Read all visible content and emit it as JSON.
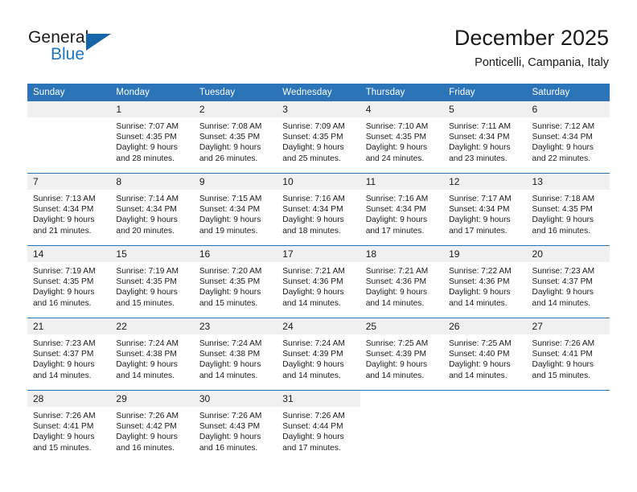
{
  "brand": {
    "name_top": "General",
    "name_bottom": "Blue",
    "flag_icon": "triangle-flag-icon",
    "color_blue": "#1f77c2",
    "color_flag": "#1565a8"
  },
  "header": {
    "title": "December 2025",
    "subtitle": "Ponticelli, Campania, Italy"
  },
  "theme": {
    "header_band": "#2b74b8",
    "daynum_band": "#f0f0f0",
    "text": "#1a1a1a"
  },
  "weekday_headers": [
    "Sunday",
    "Monday",
    "Tuesday",
    "Wednesday",
    "Thursday",
    "Friday",
    "Saturday"
  ],
  "weeks": [
    [
      {
        "day": "",
        "empty": true,
        "sunrise": "",
        "sunset": "",
        "daylight_1": "",
        "daylight_2": ""
      },
      {
        "day": "1",
        "sunrise": "Sunrise: 7:07 AM",
        "sunset": "Sunset: 4:35 PM",
        "daylight_1": "Daylight: 9 hours",
        "daylight_2": "and 28 minutes."
      },
      {
        "day": "2",
        "sunrise": "Sunrise: 7:08 AM",
        "sunset": "Sunset: 4:35 PM",
        "daylight_1": "Daylight: 9 hours",
        "daylight_2": "and 26 minutes."
      },
      {
        "day": "3",
        "sunrise": "Sunrise: 7:09 AM",
        "sunset": "Sunset: 4:35 PM",
        "daylight_1": "Daylight: 9 hours",
        "daylight_2": "and 25 minutes."
      },
      {
        "day": "4",
        "sunrise": "Sunrise: 7:10 AM",
        "sunset": "Sunset: 4:35 PM",
        "daylight_1": "Daylight: 9 hours",
        "daylight_2": "and 24 minutes."
      },
      {
        "day": "5",
        "sunrise": "Sunrise: 7:11 AM",
        "sunset": "Sunset: 4:34 PM",
        "daylight_1": "Daylight: 9 hours",
        "daylight_2": "and 23 minutes."
      },
      {
        "day": "6",
        "sunrise": "Sunrise: 7:12 AM",
        "sunset": "Sunset: 4:34 PM",
        "daylight_1": "Daylight: 9 hours",
        "daylight_2": "and 22 minutes."
      }
    ],
    [
      {
        "day": "7",
        "sunrise": "Sunrise: 7:13 AM",
        "sunset": "Sunset: 4:34 PM",
        "daylight_1": "Daylight: 9 hours",
        "daylight_2": "and 21 minutes."
      },
      {
        "day": "8",
        "sunrise": "Sunrise: 7:14 AM",
        "sunset": "Sunset: 4:34 PM",
        "daylight_1": "Daylight: 9 hours",
        "daylight_2": "and 20 minutes."
      },
      {
        "day": "9",
        "sunrise": "Sunrise: 7:15 AM",
        "sunset": "Sunset: 4:34 PM",
        "daylight_1": "Daylight: 9 hours",
        "daylight_2": "and 19 minutes."
      },
      {
        "day": "10",
        "sunrise": "Sunrise: 7:16 AM",
        "sunset": "Sunset: 4:34 PM",
        "daylight_1": "Daylight: 9 hours",
        "daylight_2": "and 18 minutes."
      },
      {
        "day": "11",
        "sunrise": "Sunrise: 7:16 AM",
        "sunset": "Sunset: 4:34 PM",
        "daylight_1": "Daylight: 9 hours",
        "daylight_2": "and 17 minutes."
      },
      {
        "day": "12",
        "sunrise": "Sunrise: 7:17 AM",
        "sunset": "Sunset: 4:34 PM",
        "daylight_1": "Daylight: 9 hours",
        "daylight_2": "and 17 minutes."
      },
      {
        "day": "13",
        "sunrise": "Sunrise: 7:18 AM",
        "sunset": "Sunset: 4:35 PM",
        "daylight_1": "Daylight: 9 hours",
        "daylight_2": "and 16 minutes."
      }
    ],
    [
      {
        "day": "14",
        "sunrise": "Sunrise: 7:19 AM",
        "sunset": "Sunset: 4:35 PM",
        "daylight_1": "Daylight: 9 hours",
        "daylight_2": "and 16 minutes."
      },
      {
        "day": "15",
        "sunrise": "Sunrise: 7:19 AM",
        "sunset": "Sunset: 4:35 PM",
        "daylight_1": "Daylight: 9 hours",
        "daylight_2": "and 15 minutes."
      },
      {
        "day": "16",
        "sunrise": "Sunrise: 7:20 AM",
        "sunset": "Sunset: 4:35 PM",
        "daylight_1": "Daylight: 9 hours",
        "daylight_2": "and 15 minutes."
      },
      {
        "day": "17",
        "sunrise": "Sunrise: 7:21 AM",
        "sunset": "Sunset: 4:36 PM",
        "daylight_1": "Daylight: 9 hours",
        "daylight_2": "and 14 minutes."
      },
      {
        "day": "18",
        "sunrise": "Sunrise: 7:21 AM",
        "sunset": "Sunset: 4:36 PM",
        "daylight_1": "Daylight: 9 hours",
        "daylight_2": "and 14 minutes."
      },
      {
        "day": "19",
        "sunrise": "Sunrise: 7:22 AM",
        "sunset": "Sunset: 4:36 PM",
        "daylight_1": "Daylight: 9 hours",
        "daylight_2": "and 14 minutes."
      },
      {
        "day": "20",
        "sunrise": "Sunrise: 7:23 AM",
        "sunset": "Sunset: 4:37 PM",
        "daylight_1": "Daylight: 9 hours",
        "daylight_2": "and 14 minutes."
      }
    ],
    [
      {
        "day": "21",
        "sunrise": "Sunrise: 7:23 AM",
        "sunset": "Sunset: 4:37 PM",
        "daylight_1": "Daylight: 9 hours",
        "daylight_2": "and 14 minutes."
      },
      {
        "day": "22",
        "sunrise": "Sunrise: 7:24 AM",
        "sunset": "Sunset: 4:38 PM",
        "daylight_1": "Daylight: 9 hours",
        "daylight_2": "and 14 minutes."
      },
      {
        "day": "23",
        "sunrise": "Sunrise: 7:24 AM",
        "sunset": "Sunset: 4:38 PM",
        "daylight_1": "Daylight: 9 hours",
        "daylight_2": "and 14 minutes."
      },
      {
        "day": "24",
        "sunrise": "Sunrise: 7:24 AM",
        "sunset": "Sunset: 4:39 PM",
        "daylight_1": "Daylight: 9 hours",
        "daylight_2": "and 14 minutes."
      },
      {
        "day": "25",
        "sunrise": "Sunrise: 7:25 AM",
        "sunset": "Sunset: 4:39 PM",
        "daylight_1": "Daylight: 9 hours",
        "daylight_2": "and 14 minutes."
      },
      {
        "day": "26",
        "sunrise": "Sunrise: 7:25 AM",
        "sunset": "Sunset: 4:40 PM",
        "daylight_1": "Daylight: 9 hours",
        "daylight_2": "and 14 minutes."
      },
      {
        "day": "27",
        "sunrise": "Sunrise: 7:26 AM",
        "sunset": "Sunset: 4:41 PM",
        "daylight_1": "Daylight: 9 hours",
        "daylight_2": "and 15 minutes."
      }
    ],
    [
      {
        "day": "28",
        "sunrise": "Sunrise: 7:26 AM",
        "sunset": "Sunset: 4:41 PM",
        "daylight_1": "Daylight: 9 hours",
        "daylight_2": "and 15 minutes."
      },
      {
        "day": "29",
        "sunrise": "Sunrise: 7:26 AM",
        "sunset": "Sunset: 4:42 PM",
        "daylight_1": "Daylight: 9 hours",
        "daylight_2": "and 16 minutes."
      },
      {
        "day": "30",
        "sunrise": "Sunrise: 7:26 AM",
        "sunset": "Sunset: 4:43 PM",
        "daylight_1": "Daylight: 9 hours",
        "daylight_2": "and 16 minutes."
      },
      {
        "day": "31",
        "sunrise": "Sunrise: 7:26 AM",
        "sunset": "Sunset: 4:44 PM",
        "daylight_1": "Daylight: 9 hours",
        "daylight_2": "and 17 minutes."
      },
      {
        "day": "",
        "blank": true,
        "sunrise": "",
        "sunset": "",
        "daylight_1": "",
        "daylight_2": ""
      },
      {
        "day": "",
        "blank": true,
        "sunrise": "",
        "sunset": "",
        "daylight_1": "",
        "daylight_2": ""
      },
      {
        "day": "",
        "blank": true,
        "sunrise": "",
        "sunset": "",
        "daylight_1": "",
        "daylight_2": ""
      }
    ]
  ]
}
